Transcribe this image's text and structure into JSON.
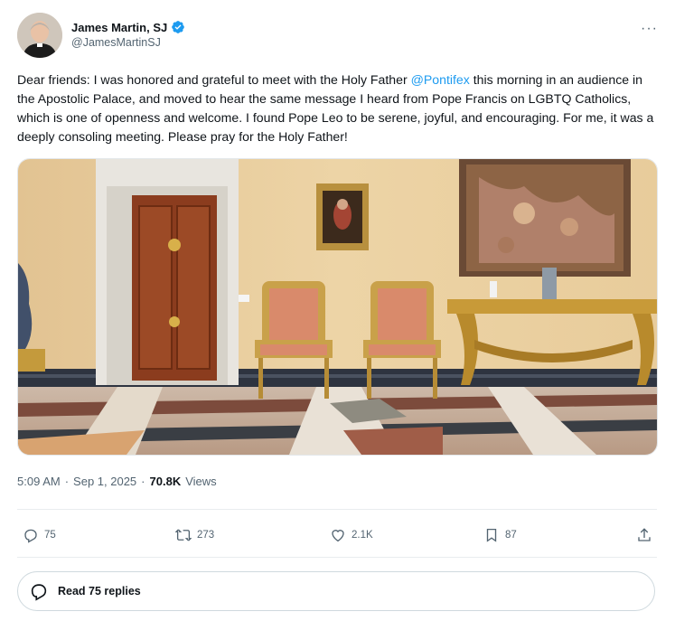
{
  "author": {
    "name": "James Martin, SJ",
    "handle": "@JamesMartinSJ",
    "avatar_icon": "profile-photo",
    "verified_color": "#1d9bf0"
  },
  "menu": {
    "more_label": "···"
  },
  "tweet": {
    "text_before": "Dear friends: I was honored and grateful to meet with the Holy Father ",
    "mention": "@Pontifex",
    "text_after": " this morning in an audience in the Apostolic Palace, and moved to hear the same message I heard from Pope Francis on LGBTQ Catholics, which is one of openness and welcome. I found Pope Leo to be serene, joyful, and encouraging. For me, it was a deeply consoling meeting. Please pray for the Holy Father!"
  },
  "meta": {
    "time": "5:09 AM",
    "date": "Sep 1, 2025",
    "views_count": "70.8K",
    "views_label": "Views"
  },
  "actions": {
    "replies": "75",
    "reposts": "273",
    "likes": "2.1K",
    "bookmarks": "87"
  },
  "read_replies_label": "Read 75 replies",
  "colors": {
    "accent": "#1d9bf0",
    "muted": "#536471",
    "text": "#0f1419"
  }
}
